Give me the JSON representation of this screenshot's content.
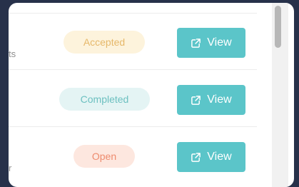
{
  "rows": [
    {
      "cut_text": "ts",
      "status": "Accepted",
      "action": "View",
      "action_icon": "external-link-icon"
    },
    {
      "cut_text": "",
      "status": "Completed",
      "action": "View",
      "action_icon": "external-link-icon"
    },
    {
      "cut_text": "r",
      "status": "Open",
      "action": "View",
      "action_icon": "external-link-icon"
    }
  ],
  "colors": {
    "accent": "#5bc5c9",
    "accepted": "#e6b86a",
    "completed": "#6cc0c0",
    "open": "#ee8b6e",
    "background": "#27314a"
  }
}
